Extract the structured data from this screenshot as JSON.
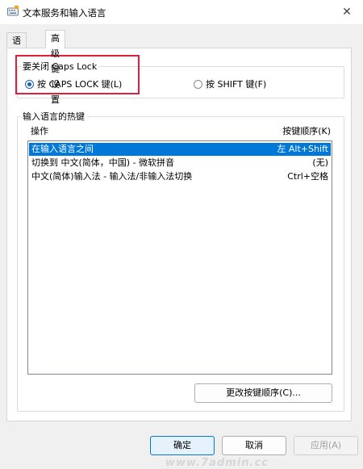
{
  "window": {
    "title": "文本服务和输入语言",
    "close_glyph": "✕"
  },
  "tabs": [
    {
      "label": "语言栏"
    },
    {
      "label": "高级键设置"
    }
  ],
  "caps_lock": {
    "legend": "要关闭 Caps Lock",
    "option1": "按 CAPS LOCK 键(L)",
    "option2": "按 SHIFT 键(F)",
    "selected": "option1"
  },
  "hotkeys": {
    "legend": "输入语言的热键",
    "col_action": "操作",
    "col_sequence": "按键顺序(K)",
    "rows": [
      {
        "action": "在输入语言之间",
        "keys": "左 Alt+Shift",
        "selected": true
      },
      {
        "action": "切换到 中文(简体，中国) - 微软拼音",
        "keys": "(无)",
        "selected": false
      },
      {
        "action": "中文(简体)输入法 - 输入法/非输入法切换",
        "keys": "Ctrl+空格",
        "selected": false
      }
    ],
    "change_button": "更改按键顺序(C)..."
  },
  "buttons": {
    "ok": "确定",
    "cancel": "取消",
    "apply": "应用(A)"
  },
  "watermark": "www.7admin.cc",
  "colors": {
    "selection": "#0078d7",
    "highlight_box": "#e0203a",
    "radio_accent": "#1a5fb4"
  }
}
